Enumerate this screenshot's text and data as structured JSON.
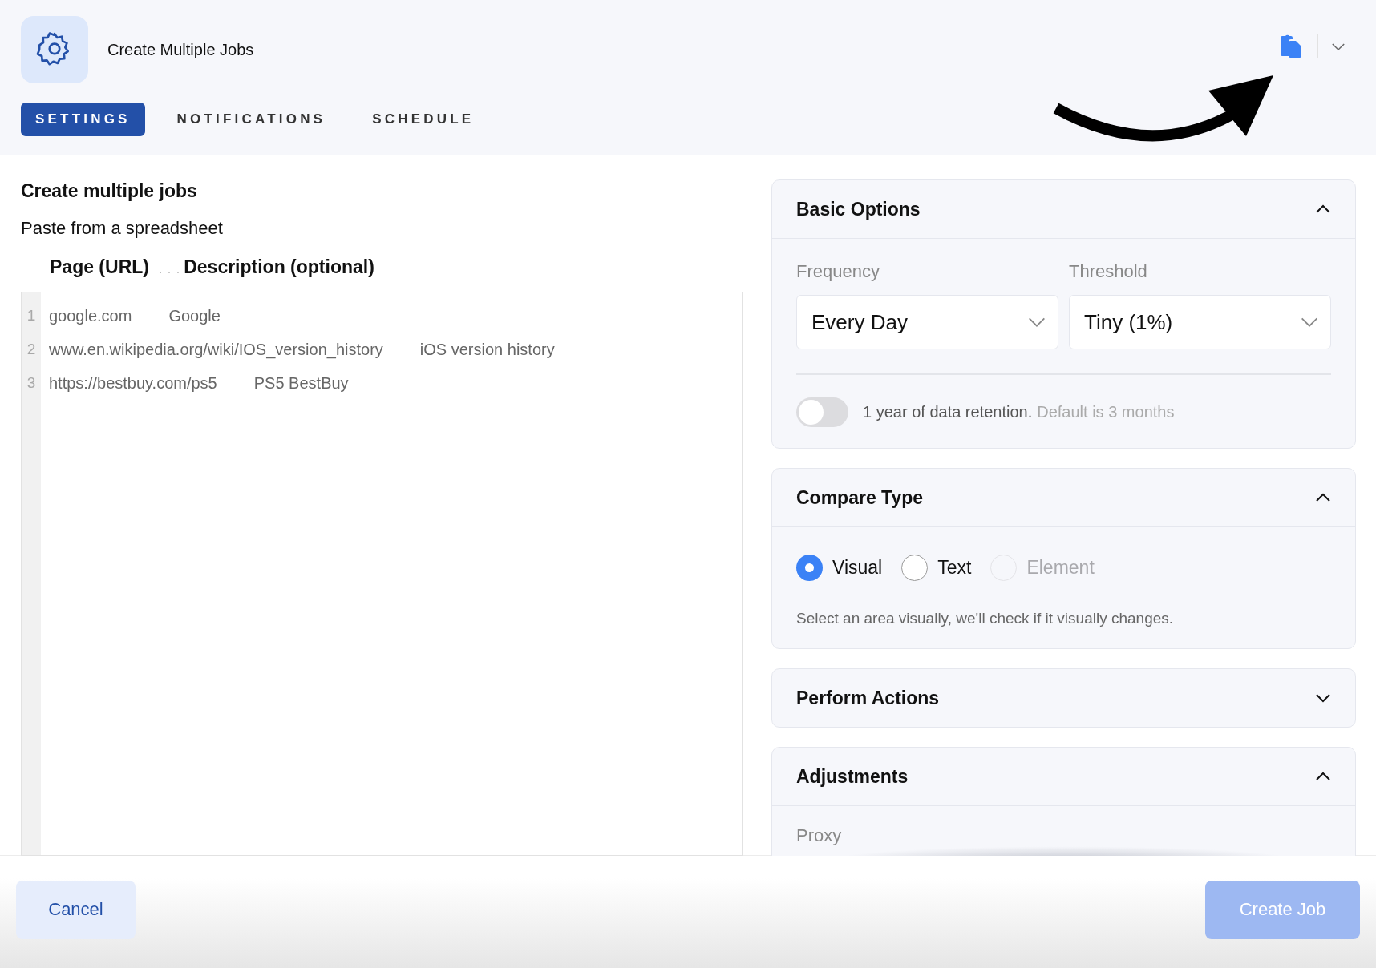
{
  "header": {
    "title": "Create Multiple Jobs",
    "tabs": [
      {
        "label": "SETTINGS",
        "selected": true
      },
      {
        "label": "NOTIFICATIONS",
        "selected": false
      },
      {
        "label": "SCHEDULE",
        "selected": false
      }
    ]
  },
  "editor": {
    "heading": "Create multiple jobs",
    "subheading": "Paste from a spreadsheet",
    "columns": [
      "Page (URL)",
      "Description (optional)"
    ],
    "column_separator": ". . .",
    "lines": [
      {
        "number": "1",
        "url": "google.com",
        "description": "Google"
      },
      {
        "number": "2",
        "url": "www.en.wikipedia.org/wiki/IOS_version_history",
        "description": "iOS version history"
      },
      {
        "number": "3",
        "url": "https://bestbuy.com/ps5",
        "description": "PS5 BestBuy"
      }
    ]
  },
  "panels": [
    {
      "kind": "options",
      "title": "Basic Options",
      "expanded": true,
      "fields": [
        {
          "label": "Frequency",
          "value": "Every Day"
        },
        {
          "label": "Threshold",
          "value": "Tiny (1%)"
        }
      ],
      "toggle": {
        "on": false,
        "label": "1 year of data retention.",
        "hint": "Default is 3 months"
      }
    },
    {
      "kind": "radios",
      "title": "Compare Type",
      "expanded": true,
      "options": [
        {
          "label": "Visual",
          "selected": true,
          "disabled": false
        },
        {
          "label": "Text",
          "selected": false,
          "disabled": false
        },
        {
          "label": "Element",
          "selected": false,
          "disabled": true
        }
      ],
      "help": "Select an area visually, we'll check if it visually changes."
    },
    {
      "title": "Perform Actions",
      "expanded": false
    },
    {
      "kind": "label",
      "title": "Adjustments",
      "expanded": true,
      "label": "Proxy"
    }
  ],
  "footer": {
    "buttons": [
      {
        "label": "Cancel",
        "kind": "secondary",
        "disabled": false
      },
      {
        "label": "Create Job",
        "kind": "primary",
        "disabled": true
      }
    ]
  }
}
